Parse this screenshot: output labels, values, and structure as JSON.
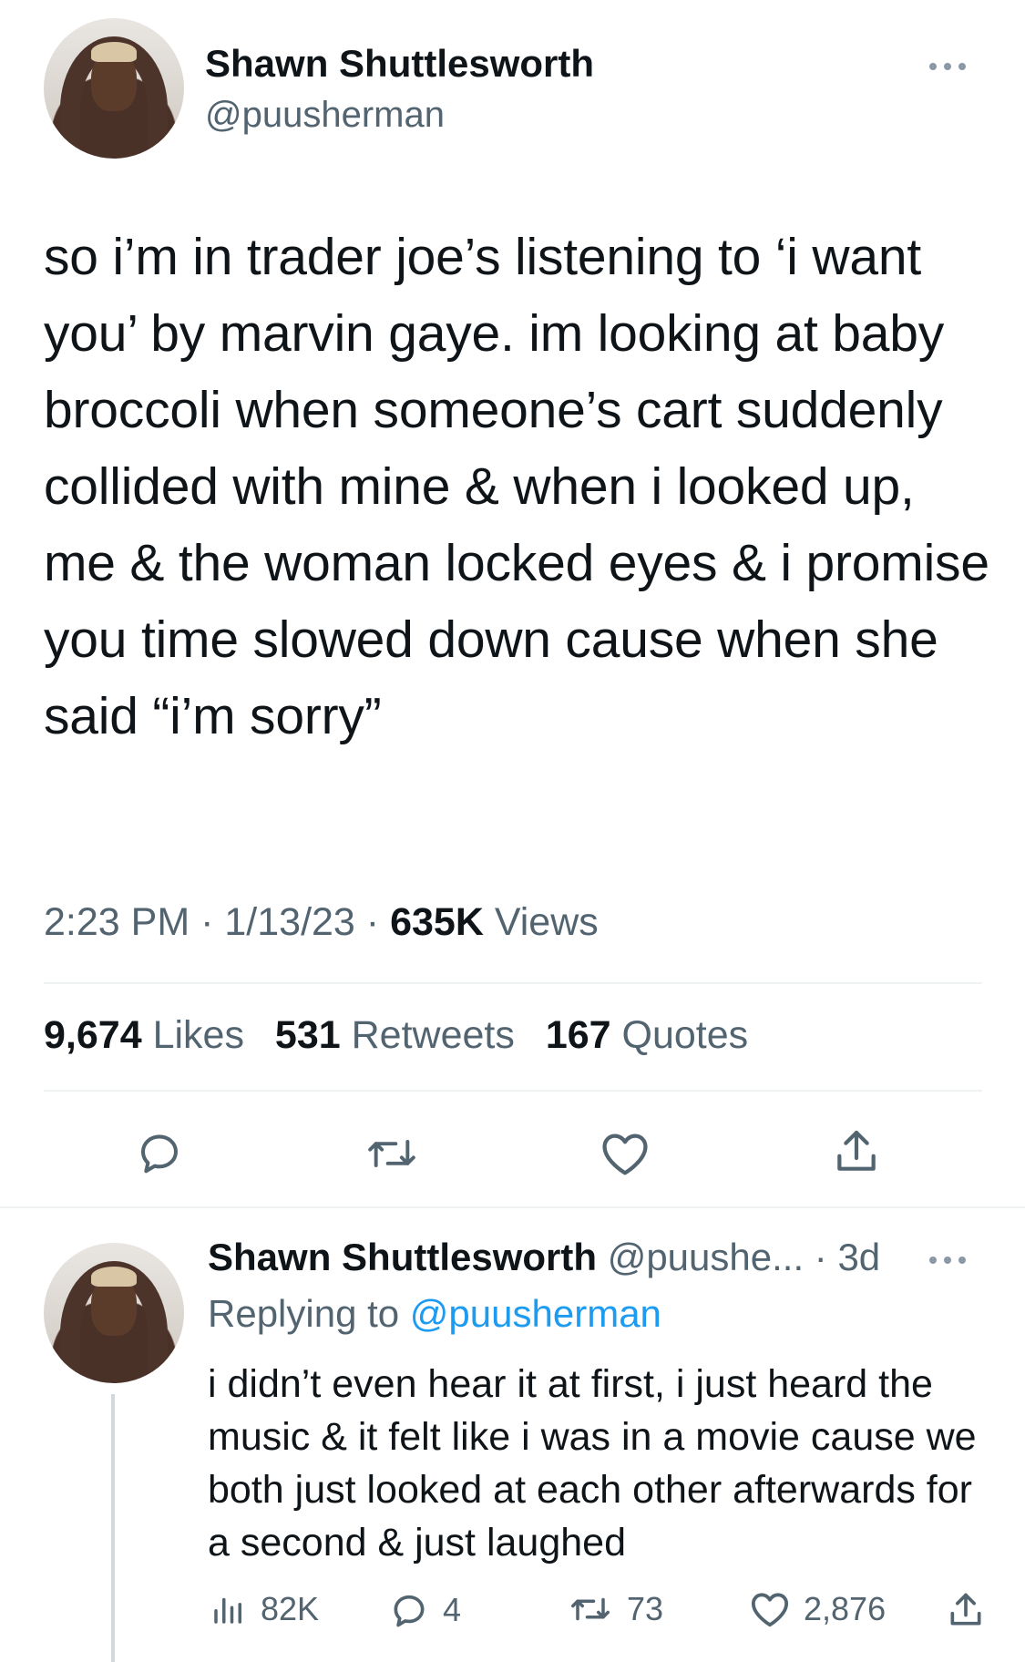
{
  "tweet": {
    "author_name": "Shawn Shuttlesworth",
    "author_handle": "@puusherman",
    "text": "so i’m in trader joe’s listening to ‘i want you’ by marvin gaye. im looking at baby broccoli when someone’s cart suddenly collided with mine & when i looked up, me & the woman locked eyes & i promise you time slowed down cause when she said “i’m sorry”",
    "time": "2:23 PM",
    "date": "1/13/23",
    "views_count": "635K",
    "views_label": "Views",
    "likes_count": "9,674",
    "likes_label": "Likes",
    "retweets_count": "531",
    "retweets_label": "Retweets",
    "quotes_count": "167",
    "quotes_label": "Quotes",
    "actions": [
      "reply-icon",
      "retweet-icon",
      "like-icon",
      "share-icon"
    ]
  },
  "reply": {
    "author_name": "Shawn Shuttlesworth",
    "author_handle_truncated": "@puushe...",
    "age": "3d",
    "replying_to_label": "Replying to",
    "replying_to_handle": "@puusherman",
    "text": "i didn’t even hear it at first, i just heard the music & it felt like i was in a movie cause we both just looked at each other afterwards for a second & just laughed",
    "views": "82K",
    "replies": "4",
    "retweets": "73",
    "likes": "2,876"
  },
  "colors": {
    "text_primary": "#0f1419",
    "text_secondary": "#536471",
    "link": "#1d9bf0",
    "divider": "#eff3f4"
  }
}
